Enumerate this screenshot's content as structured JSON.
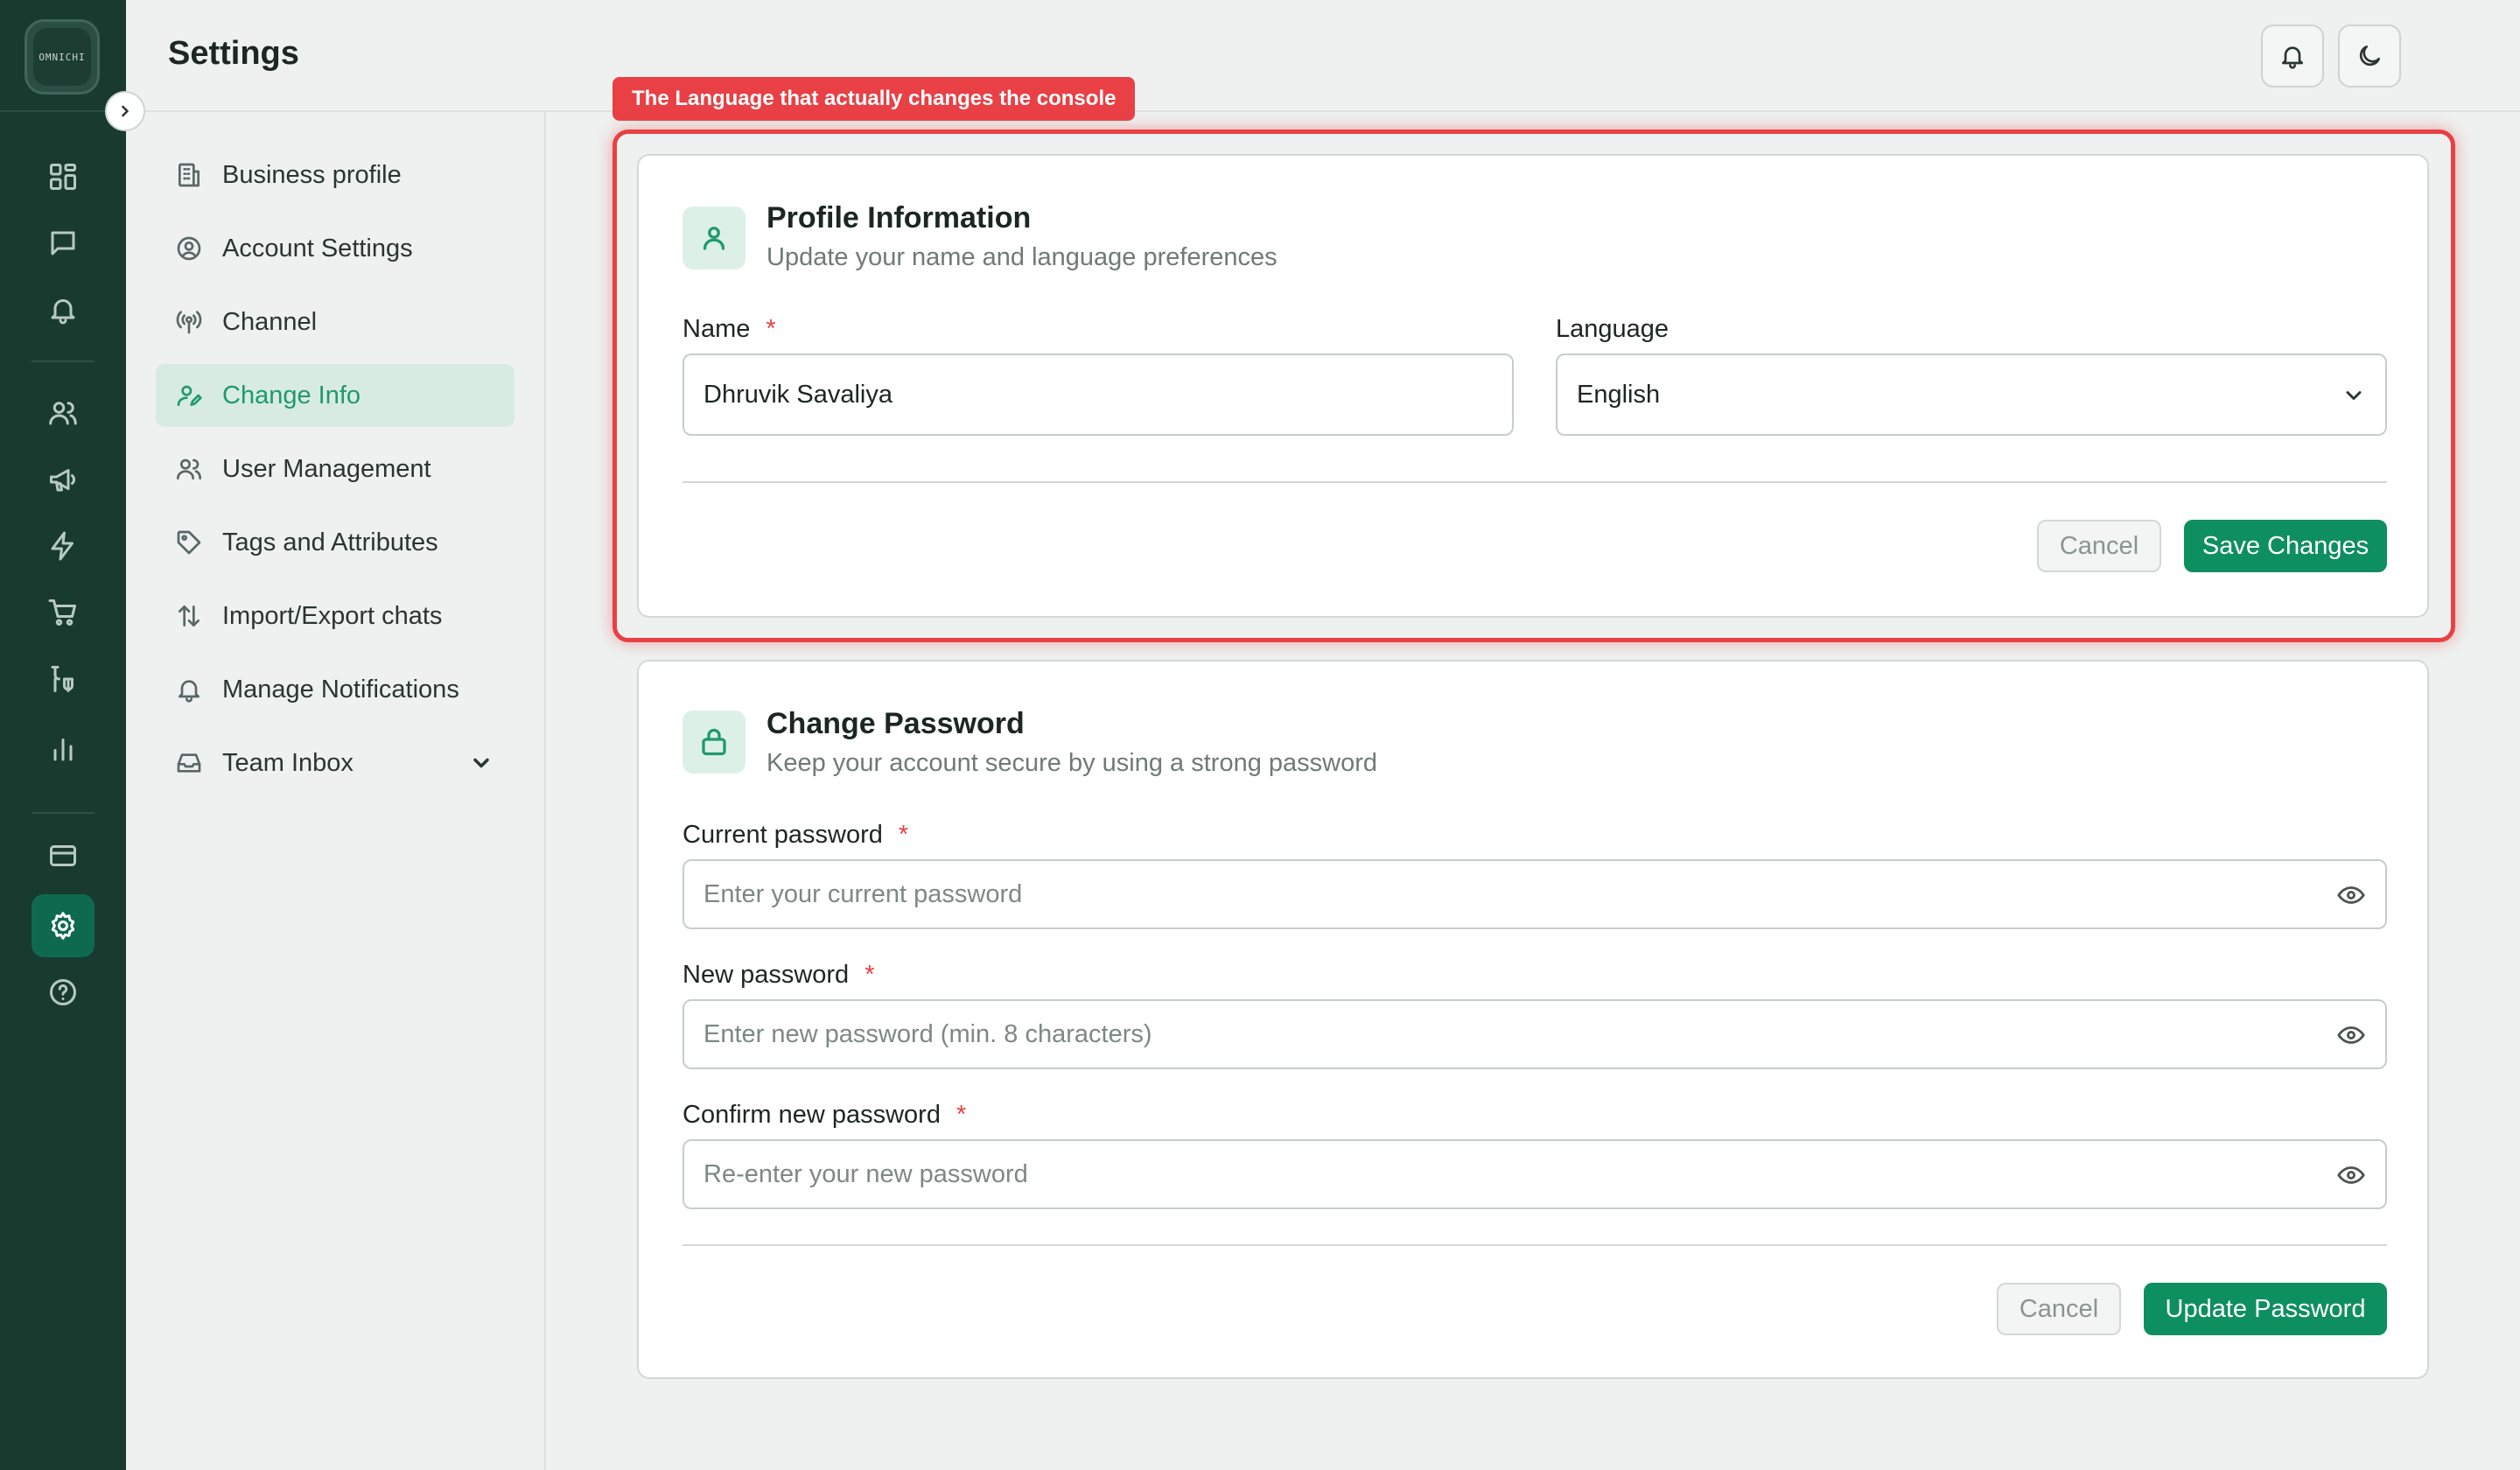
{
  "app": {
    "logo_text": "OMNICHI",
    "page_title": "Settings"
  },
  "rail": {
    "icons": [
      "dashboard-icon",
      "chat-icon",
      "bell-icon",
      "users-icon",
      "megaphone-icon",
      "bolt-icon",
      "cart-icon",
      "flow-icon",
      "bar-chart-icon",
      "credit-card-icon",
      "gear-icon",
      "help-icon"
    ],
    "active": "gear-icon"
  },
  "subnav": {
    "items": [
      {
        "label": "Business profile",
        "icon": "building-icon"
      },
      {
        "label": "Account Settings",
        "icon": "user-circle-icon"
      },
      {
        "label": "Channel",
        "icon": "broadcast-icon"
      },
      {
        "label": "Change Info",
        "icon": "user-edit-icon",
        "active": true
      },
      {
        "label": "User Management",
        "icon": "users-icon"
      },
      {
        "label": "Tags and Attributes",
        "icon": "tag-icon"
      },
      {
        "label": "Import/Export chats",
        "icon": "arrows-updown-icon"
      },
      {
        "label": "Manage Notifications",
        "icon": "bell-icon"
      },
      {
        "label": "Team Inbox",
        "icon": "inbox-icon",
        "has_dropdown": true
      }
    ]
  },
  "annotation": {
    "tag": "The Language that actually changes the console",
    "color": "#e84045"
  },
  "profile": {
    "title": "Profile Information",
    "subtitle": "Update your name and language preferences",
    "name_label": "Name",
    "name_value": "Dhruvik Savaliya",
    "language_label": "Language",
    "language_value": "English",
    "cancel_label": "Cancel",
    "save_label": "Save Changes"
  },
  "password": {
    "title": "Change Password",
    "subtitle": "Keep your account secure by using a strong password",
    "current_label": "Current password",
    "current_placeholder": "Enter your current password",
    "new_label": "New password",
    "new_placeholder": "Enter new password (min. 8 characters)",
    "confirm_label": "Confirm new password",
    "confirm_placeholder": "Re-enter your new password",
    "cancel_label": "Cancel",
    "update_label": "Update Password"
  },
  "required_marker": "*",
  "colors": {
    "rail_bg": "#183a2f",
    "accent": "#0e8f60",
    "active_nav_bg": "#d8ebe3",
    "highlight": "#e84045"
  }
}
